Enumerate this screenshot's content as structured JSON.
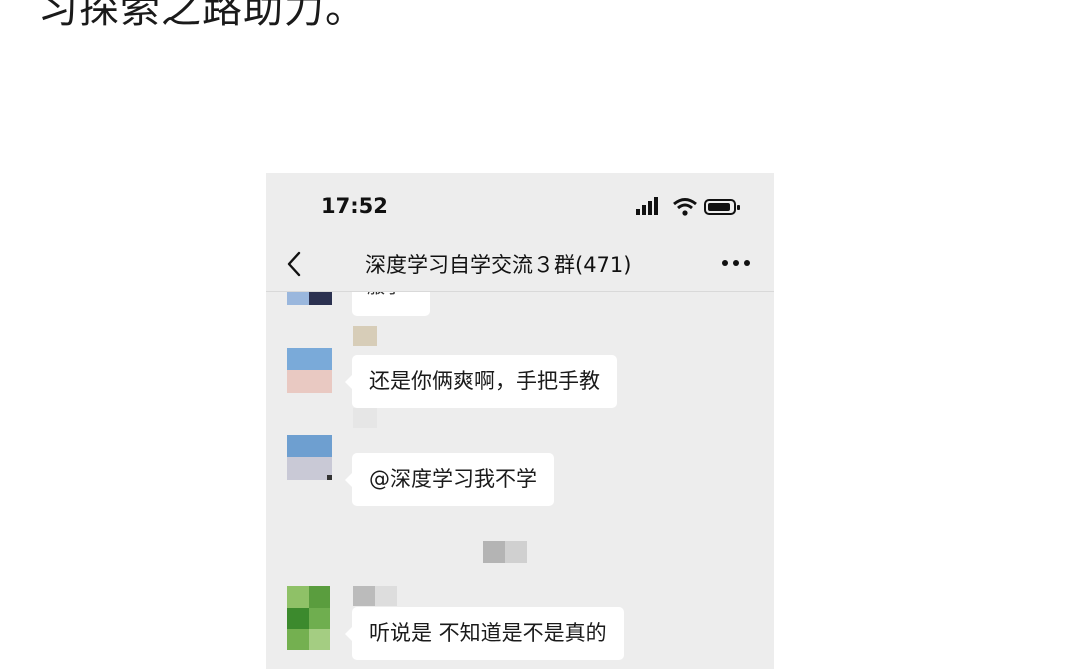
{
  "article": {
    "text_fragment": "习探索之路助力。"
  },
  "status_bar": {
    "time": "17:52"
  },
  "nav": {
    "title": "深度学习自学交流３群(471)"
  },
  "messages": [
    {
      "text": "服了"
    },
    {
      "text": "还是你俩爽啊，手把手教"
    },
    {
      "text": "@深度学习我不学"
    },
    {
      "text": "听说是  不知道是不是真的"
    }
  ],
  "icons": {
    "back": "chevron-left-icon",
    "more": "more-icon",
    "signal": "signal-icon",
    "wifi": "wifi-icon",
    "battery": "battery-icon"
  },
  "colors": {
    "chat_background": "#ededed",
    "bubble_background": "#ffffff"
  }
}
